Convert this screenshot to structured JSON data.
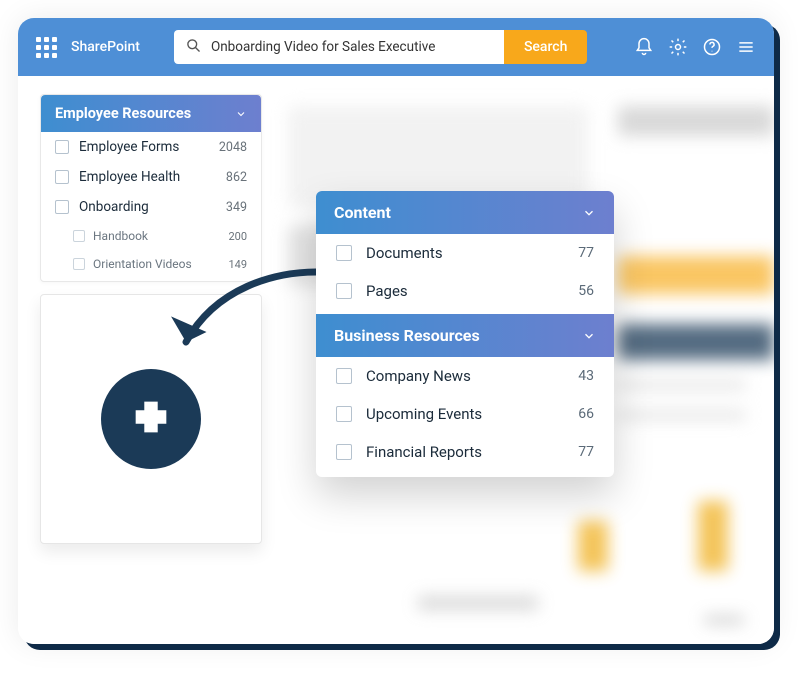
{
  "header": {
    "brand": "SharePoint",
    "search_value": "Onboarding Video for Sales Executive",
    "search_button": "Search"
  },
  "employee_resources": {
    "title": "Employee Resources",
    "items": [
      {
        "label": "Employee Forms",
        "count": "2048"
      },
      {
        "label": "Employee Health",
        "count": "862"
      },
      {
        "label": "Onboarding",
        "count": "349"
      }
    ],
    "subitems": [
      {
        "label": "Handbook",
        "count": "200"
      },
      {
        "label": "Orientation Videos",
        "count": "149"
      }
    ]
  },
  "popup": {
    "sections": [
      {
        "title": "Content",
        "items": [
          {
            "label": "Documents",
            "count": "77"
          },
          {
            "label": "Pages",
            "count": "56"
          }
        ]
      },
      {
        "title": "Business Resources",
        "items": [
          {
            "label": "Company News",
            "count": "43"
          },
          {
            "label": "Upcoming Events",
            "count": "66"
          },
          {
            "label": "Financial Reports",
            "count": "77"
          }
        ]
      }
    ]
  }
}
